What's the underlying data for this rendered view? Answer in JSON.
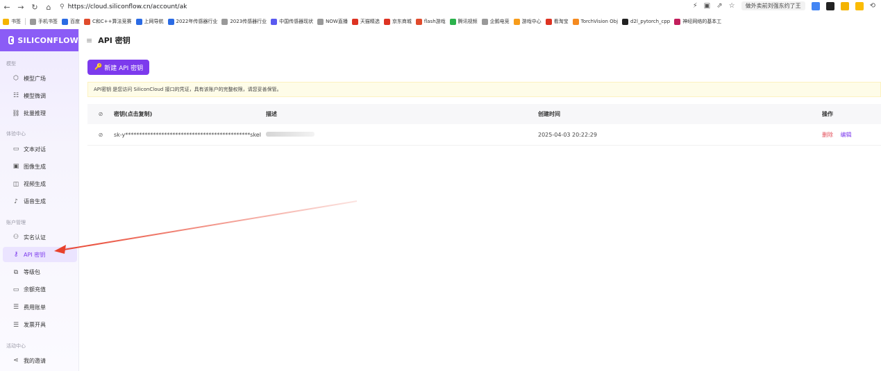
{
  "browser": {
    "url": "https://cloud.siliconflow.cn/account/ak",
    "news_pill": "做外卖前刘强东约了王",
    "bookmarks": [
      "书签",
      "手机书签",
      "百度",
      "C和C++算法竞赛",
      "上网导航",
      "2022年传感器行业",
      "2023传感器行业",
      "中国传感器现状",
      "NOW直播",
      "天猫精选",
      "京东商城",
      "flash游戏",
      "腾讯视频",
      "企鹅电竞",
      "游戏中心",
      "看淘宝",
      "TorchVision Obj",
      "d2l_pytorch_cpp",
      "神经网络的基本工"
    ]
  },
  "sidebar": {
    "logo": "SILICONFLOW",
    "section_models": "模型",
    "section_experience": "体验中心",
    "section_account": "账户管理",
    "section_activity": "活动中心",
    "items_models": [
      {
        "label": "模型广场",
        "icon": "cube-icon"
      },
      {
        "label": "模型微调",
        "icon": "tune-icon"
      },
      {
        "label": "批量推理",
        "icon": "batch-icon"
      }
    ],
    "items_experience": [
      {
        "label": "文本对话",
        "icon": "chat-icon"
      },
      {
        "label": "图像生成",
        "icon": "image-icon"
      },
      {
        "label": "视频生成",
        "icon": "video-icon"
      },
      {
        "label": "语音生成",
        "icon": "mic-icon"
      }
    ],
    "items_account": [
      {
        "label": "实名认证",
        "icon": "user-check-icon"
      },
      {
        "label": "API 密钥",
        "icon": "key-icon",
        "active": true
      },
      {
        "label": "等级包",
        "icon": "package-icon"
      },
      {
        "label": "余额充值",
        "icon": "wallet-icon"
      },
      {
        "label": "费用账单",
        "icon": "bill-icon"
      },
      {
        "label": "发票开具",
        "icon": "invoice-icon"
      }
    ],
    "items_activity": [
      {
        "label": "我的邀请",
        "icon": "share-icon"
      }
    ]
  },
  "main": {
    "title": "API 密钥",
    "new_button": "新建 API 密钥",
    "notice": "API密钥 是您访问 SiliconCloud 接口的凭证，具有该账户的完整权限，请您妥善保管。",
    "table": {
      "headers": [
        "密钥(点击复制)",
        "描述",
        "创建时间",
        "操作"
      ],
      "rows": [
        {
          "key": "sk-y*********************************************skel",
          "created": "2025-04-03 20:22:29",
          "delete": "删除",
          "edit": "编辑"
        }
      ]
    }
  },
  "colors": {
    "accent": "#7c3aed",
    "logo_bg": "#8b5cf6",
    "danger": "#e34d59",
    "arrow": "#e8412c"
  }
}
